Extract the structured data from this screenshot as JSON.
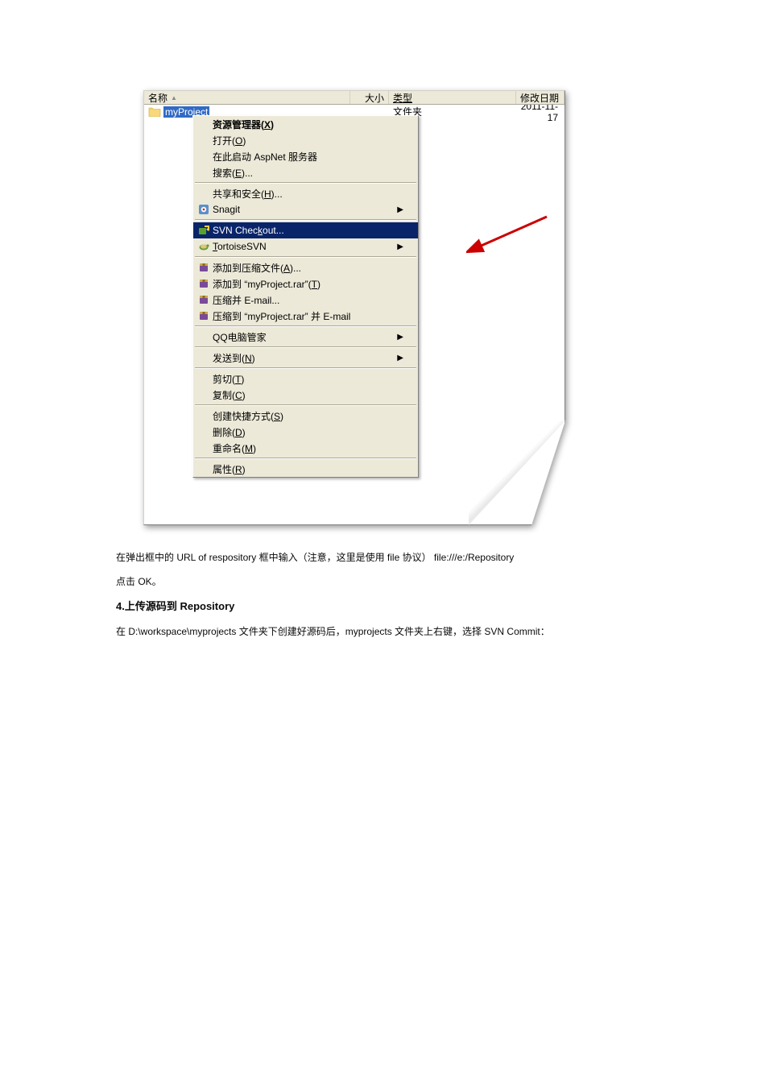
{
  "explorer": {
    "cols": {
      "name": "名称",
      "size": "大小",
      "type": "类型",
      "date": "修改日期"
    },
    "row": {
      "name": "myProject",
      "type": "文件夹",
      "date": "2011-11-17"
    }
  },
  "menu": {
    "explorer_mgr": "资源管理器(X)",
    "open": "打开(O)",
    "aspnet": "在此启动 AspNet 服务器",
    "search": "搜索(E)...",
    "share": "共享和安全(H)...",
    "snagit": "Snagit",
    "svn_checkout": "SVN Checkout...",
    "tortoisesvn": "TortoiseSVN",
    "add_archive": "添加到压缩文件(A)...",
    "add_rar": "添加到 \"myProject.rar\"(T)",
    "compress_email": "压缩并 E-mail...",
    "compress_rar_email": "压缩到 \"myProject.rar\" 并 E-mail",
    "qq_guard": "QQ电脑管家",
    "send_to": "发送到(N)",
    "cut": "剪切(T)",
    "copy": "复制(C)",
    "shortcut": "创建快捷方式(S)",
    "delete": "删除(D)",
    "rename": "重命名(M)",
    "properties": "属性(R)"
  },
  "doc": {
    "p1": "在弹出框中的 URL of respository 框中输入（注意，这里是使用 file 协议）  file:///e:/Repository",
    "p2": "点击 OK。",
    "h4": "4.上传源码到 Repository",
    "p3": "在 D:\\workspace\\myprojects 文件夹下创建好源码后，myprojects 文件夹上右键，选择 SVN Commit："
  }
}
